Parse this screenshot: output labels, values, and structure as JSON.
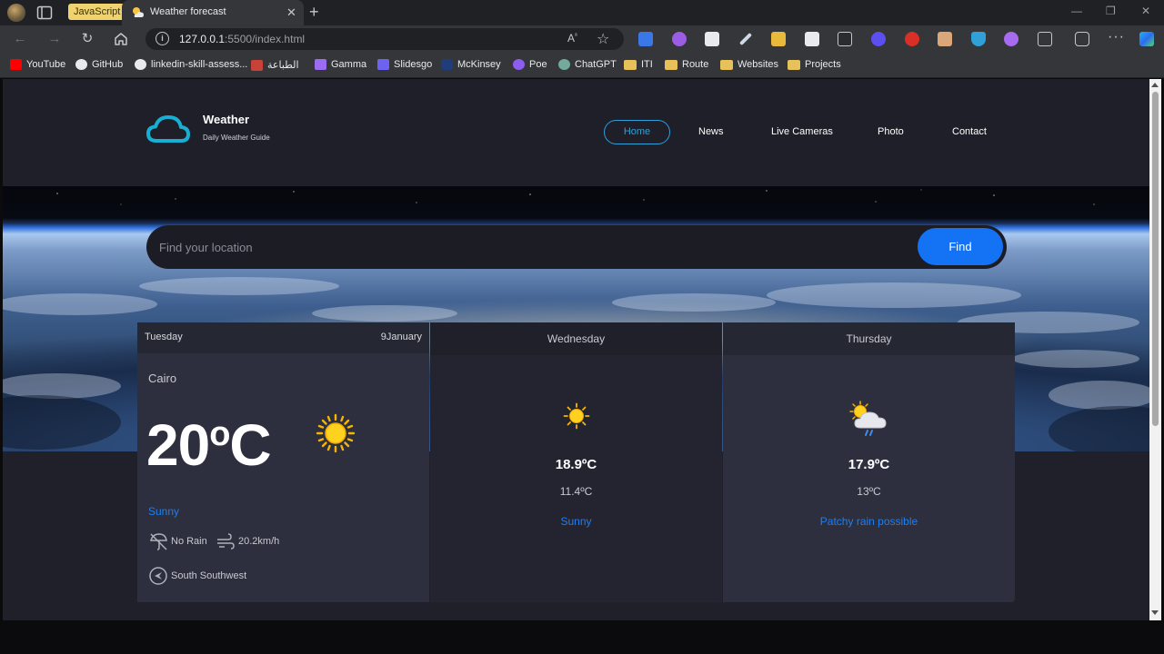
{
  "browser": {
    "tab_group": "JavaScript",
    "tab_title": "Weather forecast",
    "url_host": "127.0.0.1",
    "url_rest": ":5500/index.html",
    "bookmarks": [
      "YouTube",
      "GitHub",
      "linkedin-skill-assess...",
      "الطباعة",
      "Gamma",
      "Slidesgo",
      "McKinsey",
      "Poe",
      "ChatGPT",
      "ITI",
      "Route",
      "Websites",
      "Projects"
    ]
  },
  "site": {
    "logo_title": "Weather",
    "logo_subtitle": "Daily Weather Guide",
    "nav": [
      "Home",
      "News",
      "Live Cameras",
      "Photo",
      "Contact"
    ],
    "search_placeholder": "Find your location",
    "find_label": "Find"
  },
  "today": {
    "day": "Tuesday",
    "date": "9January",
    "city": "Cairo",
    "temp_value": "20",
    "temp_unit": "o",
    "temp_scale": "C",
    "condition": "Sunny",
    "rain": "No Rain",
    "wind_speed": "20.2km/h",
    "wind_dir": "South Southwest"
  },
  "forecast": [
    {
      "day": "Wednesday",
      "max": "18.9ºC",
      "min": "11.4ºC",
      "condition": "Sunny",
      "icon": "sun-icon"
    },
    {
      "day": "Thursday",
      "max": "17.9ºC",
      "min": "13ºC",
      "condition": "Patchy rain possible",
      "icon": "sun-cloud-rain-icon"
    }
  ],
  "colors": {
    "accent": "#1473f5",
    "condition_text": "#1e7ef0",
    "home_border": "#2fa0d8",
    "logo_cloud": "#17b0d4"
  }
}
